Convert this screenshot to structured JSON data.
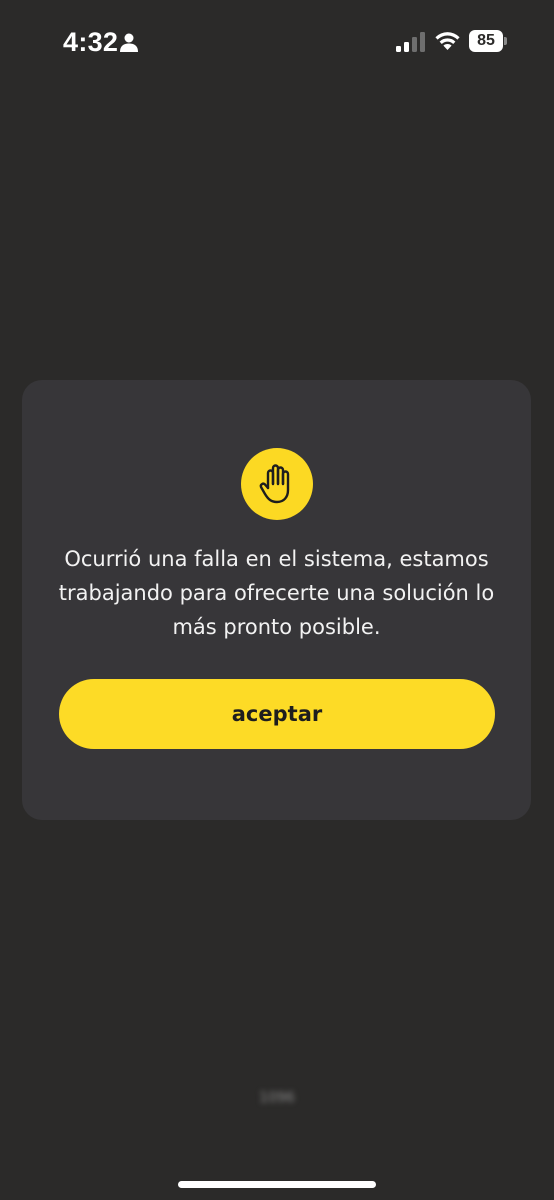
{
  "status_bar": {
    "time": "4:32",
    "battery_level": "85",
    "signal_strength": 0.5,
    "icons": [
      "person-icon",
      "cellular-signal-icon",
      "wifi-icon",
      "battery-icon"
    ]
  },
  "dialog": {
    "icon": "raised-hand-icon",
    "message": "Ocurrió una falla en el sistema, estamos trabajando para ofrecerte una solución lo más pronto posible.",
    "accept_label": "aceptar"
  },
  "footer": {
    "version": "1096"
  },
  "colors": {
    "background": "#2b2a29",
    "dialog": "#373639",
    "accent": "#fddb26",
    "button_text": "#1e1e1e"
  }
}
